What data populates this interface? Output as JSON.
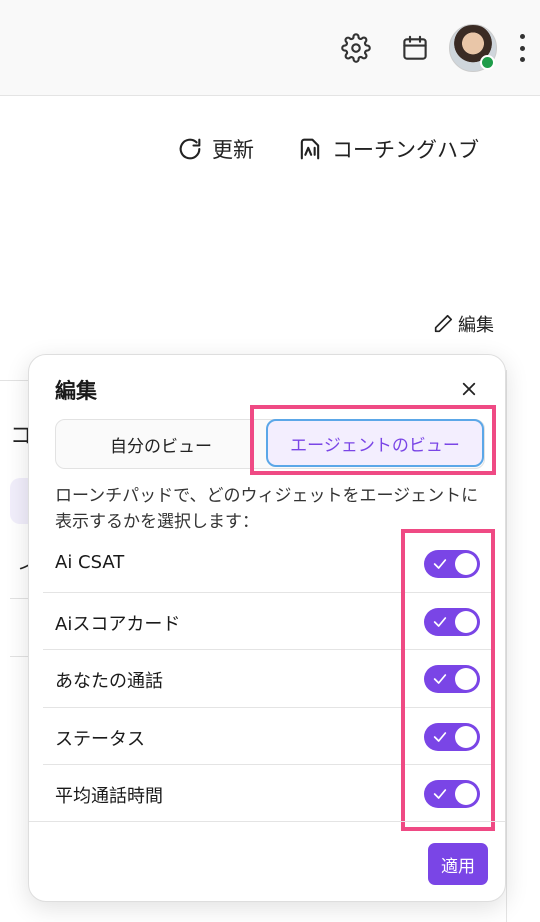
{
  "header": {
    "icons": [
      "gear-icon",
      "calendar-icon",
      "avatar",
      "kebab-menu-icon"
    ],
    "status_color": "#1f9d4a"
  },
  "actions": {
    "refresh_label": "更新",
    "coaching_hub_label": "コーチングハブ",
    "edit_label": "編集"
  },
  "background": {
    "fragment_1": "コ",
    "fragment_2": "イ"
  },
  "modal": {
    "title": "編集",
    "tabs": {
      "mine": "自分のビュー",
      "agent": "エージェントのビュー",
      "selected": "agent"
    },
    "description": "ローンチパッドで、どのウィジェットをエージェントに表示するかを選択します：",
    "items": [
      {
        "label": "Ai CSAT",
        "enabled": true
      },
      {
        "label": "Aiスコアカード",
        "enabled": true
      },
      {
        "label": "あなたの通話",
        "enabled": true
      },
      {
        "label": "ステータス",
        "enabled": true
      },
      {
        "label": "平均通話時間",
        "enabled": true
      }
    ],
    "apply_label": "適用"
  },
  "colors": {
    "accent": "#7a45e6",
    "highlight": "#ef4a84",
    "focus_ring": "#5ba7e8"
  }
}
